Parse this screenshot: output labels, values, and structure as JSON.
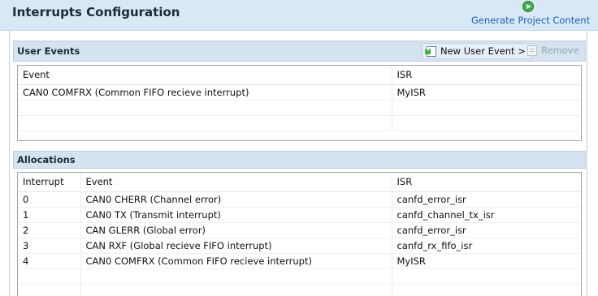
{
  "header": {
    "title": "Interrupts Configuration",
    "generate_label": "Generate Project Content"
  },
  "user_events": {
    "title": "User Events",
    "new_label": "New User Event >",
    "remove_label": "Remove",
    "columns": [
      "Event",
      "ISR"
    ],
    "rows": [
      [
        "CAN0 COMFRX (Common FIFO recieve interrupt)",
        "MyISR"
      ]
    ]
  },
  "allocations": {
    "title": "Allocations",
    "columns": [
      "Interrupt",
      "Event",
      "ISR"
    ],
    "rows": [
      [
        "0",
        "CAN0 CHERR (Channel error)",
        "canfd_error_isr"
      ],
      [
        "1",
        "CAN0 TX (Transmit interrupt)",
        "canfd_channel_tx_isr"
      ],
      [
        "2",
        "CAN GLERR (Global error)",
        "canfd_error_isr"
      ],
      [
        "3",
        "CAN RXF (Global recieve FIFO interrupt)",
        "canfd_rx_fifo_isr"
      ],
      [
        "4",
        "CAN0 COMFRX (Common FIFO recieve interrupt)",
        "MyISR"
      ]
    ]
  },
  "colors": {
    "header_bg": "#d9e8f7",
    "section_bg": "#d5e2f0",
    "link": "#1b5fae",
    "disabled": "#9aa5b1",
    "accent_green": "#3fae49"
  },
  "icons": {
    "generate": "play-circle-icon",
    "new_user_event": "new-event-icon",
    "remove": "remove-icon"
  }
}
